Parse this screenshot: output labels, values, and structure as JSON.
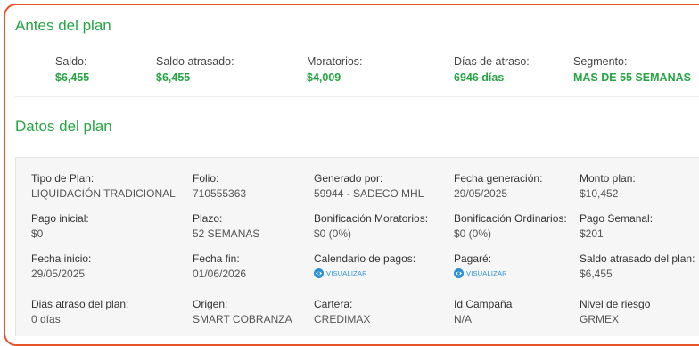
{
  "antes": {
    "title": "Antes del plan",
    "items": [
      {
        "label": "Saldo:",
        "value": "$6,455"
      },
      {
        "label": "Saldo atrasado:",
        "value": "$6,455"
      },
      {
        "label": "Moratorios:",
        "value": "$4,009"
      },
      {
        "label": "Días de atraso:",
        "value": "6946 días"
      },
      {
        "label": "Segmento:",
        "value": "MAS DE 55 SEMANAS"
      }
    ]
  },
  "datos": {
    "title": "Datos del plan",
    "visualizar_label": "VISUALIZAR",
    "rows": [
      [
        {
          "label": "Tipo de Plan:",
          "value": "LIQUIDACIÓN TRADICIONAL"
        },
        {
          "label": "Folio:",
          "value": "710555363"
        },
        {
          "label": "Generado por:",
          "value": "59944 - SADECO MHL"
        },
        {
          "label": "Fecha generación:",
          "value": "29/05/2025"
        },
        {
          "label": "Monto plan:",
          "value": "$10,452"
        }
      ],
      [
        {
          "label": "Pago inicial:",
          "value": "$0"
        },
        {
          "label": "Plazo:",
          "value": "52 SEMANAS"
        },
        {
          "label": "Bonificación Moratorios:",
          "value": "$0 (0%)"
        },
        {
          "label": "Bonificación Ordinarios:",
          "value": "$0 (0%)"
        },
        {
          "label": "Pago Semanal:",
          "value": "$201"
        }
      ],
      [
        {
          "label": "Fecha inicio:",
          "value": "29/05/2025"
        },
        {
          "label": "Fecha fin:",
          "value": "01/06/2026"
        },
        {
          "label": "Calendario de pagos:",
          "value": null
        },
        {
          "label": "Pagaré:",
          "value": null
        },
        {
          "label": "Saldo atrasado del plan:",
          "value": "$6,455"
        }
      ],
      [
        {
          "label": "Dias atraso del plan:",
          "value": "0 días"
        },
        {
          "label": "Origen:",
          "value": "SMART COBRANZA"
        },
        {
          "label": "Cartera:",
          "value": "CREDIMAX"
        },
        {
          "label": "Id Campaña",
          "value": "N/A"
        },
        {
          "label": "Nivel de riesgo",
          "value": "GRMEX"
        }
      ]
    ]
  },
  "colors": {
    "accent_green": "#27a544",
    "border_orange": "#e8542a",
    "link_blue": "#2a8fd6"
  }
}
